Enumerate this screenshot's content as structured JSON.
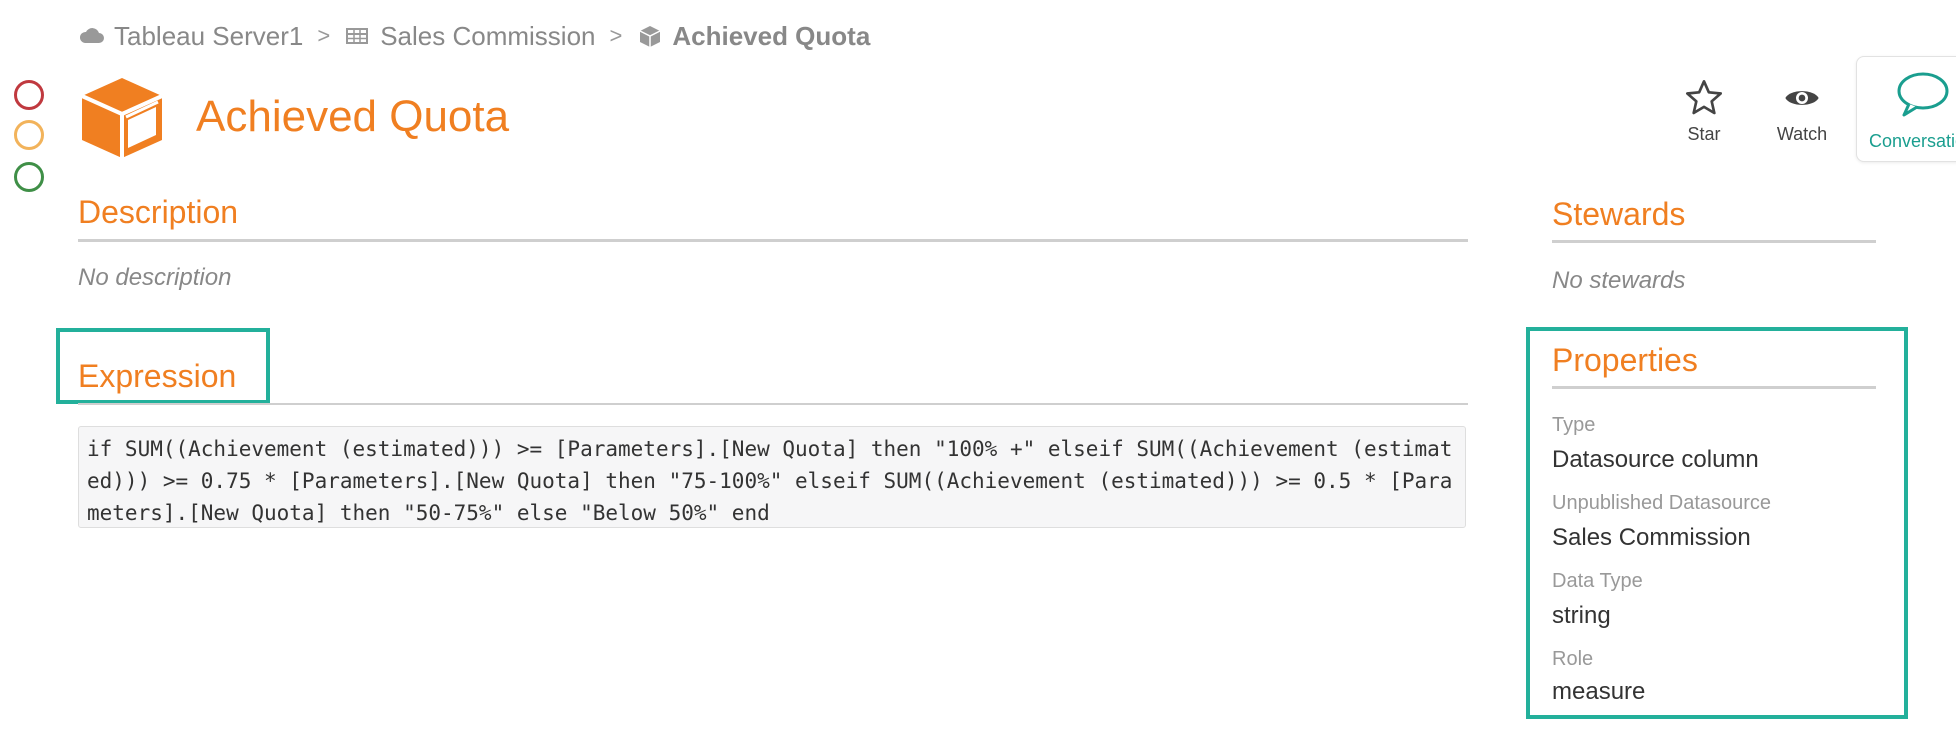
{
  "breadcrumb": {
    "items": [
      {
        "label": "Tableau Server1",
        "icon": "cloud-icon"
      },
      {
        "label": "Sales Commission",
        "icon": "datasource-icon"
      },
      {
        "label": "Achieved Quota",
        "icon": "cube-icon"
      }
    ],
    "separator": ">"
  },
  "status_indicators": [
    "red",
    "yellow",
    "green"
  ],
  "colors": {
    "accent": "#f07f21",
    "highlight": "#23b09b",
    "red": "#c0393f",
    "yellow": "#f2b35b",
    "green": "#3f8f47"
  },
  "title": "Achieved Quota",
  "actions": {
    "star": "Star",
    "watch": "Watch",
    "conversation": "Conversations"
  },
  "description": {
    "heading": "Description",
    "text": "No description"
  },
  "expression": {
    "heading": "Expression",
    "code": "if SUM((Achievement (estimated))) >= [Parameters].[New Quota] then \"100% +\" elseif SUM((Achievement (estimated))) >= 0.75 * [Parameters].[New Quota] then \"75-100%\" elseif SUM((Achievement (estimated))) >= 0.5 * [Parameters].[New Quota] then \"50-75%\" else \"Below 50%\" end"
  },
  "stewards": {
    "heading": "Stewards",
    "text": "No stewards"
  },
  "properties": {
    "heading": "Properties",
    "items": [
      {
        "label": "Type",
        "value": "Datasource column"
      },
      {
        "label": "Unpublished Datasource",
        "value": "Sales Commission"
      },
      {
        "label": "Data Type",
        "value": "string"
      },
      {
        "label": "Role",
        "value": "measure"
      }
    ]
  }
}
